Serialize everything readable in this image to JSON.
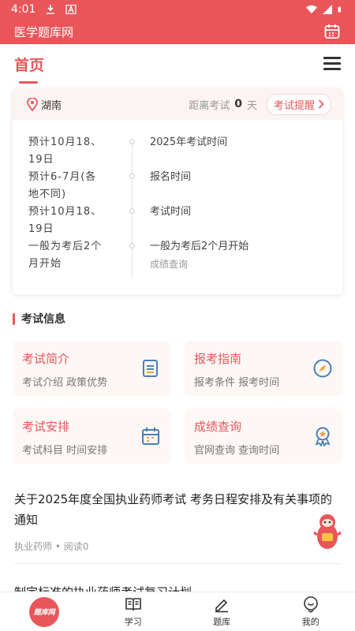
{
  "status_bar": {
    "time": "4:01"
  },
  "app_bar": {
    "title": "医学题库网"
  },
  "nav": {
    "home_label": "首页"
  },
  "exam_card": {
    "location": "湖南",
    "countdown_label": "距离考试",
    "countdown_days": "0",
    "countdown_unit": "天",
    "remind_label": "考试提醒",
    "schedule": [
      {
        "date": "预计10月18、19日",
        "event": "2025年考试时间",
        "sub": ""
      },
      {
        "date": "预计6-7月(各地不同)",
        "event": "报名时间",
        "sub": ""
      },
      {
        "date": "预计10月18、19日",
        "event": "考试时间",
        "sub": ""
      },
      {
        "date": "一般为考后2个月开始",
        "event": "一般为考后2个月开始",
        "sub": "成绩查询"
      }
    ]
  },
  "exam_info": {
    "section_title": "考试信息",
    "tiles": [
      {
        "title": "考试简介",
        "subtitle": "考试介绍 政策优势",
        "icon": "document-icon"
      },
      {
        "title": "报考指南",
        "subtitle": "报考条件 报考时间",
        "icon": "compass-icon"
      },
      {
        "title": "考试安排",
        "subtitle": "考试科目 时间安排",
        "icon": "calendar-icon"
      },
      {
        "title": "成绩查询",
        "subtitle": "官网查询 查询时间",
        "icon": "award-icon"
      }
    ]
  },
  "articles": [
    {
      "title": "关于2025年度全国执业药师考试 考务日程安排及有关事项的通知",
      "category": "执业药师",
      "reads": "阅读0"
    },
    {
      "title": "制定标准的执业药师考试复习计划"
    }
  ],
  "bottom_nav": {
    "logo_text": "题库网",
    "items": [
      {
        "label": "学习",
        "icon": "book-icon"
      },
      {
        "label": "题库",
        "icon": "pencil-icon"
      },
      {
        "label": "我的",
        "icon": "profile-icon"
      }
    ]
  },
  "colors": {
    "accent": "#e9565a",
    "tile_bg": "#fdf7f6",
    "icon_blue": "#4a7fb8",
    "icon_orange": "#f0a14a"
  }
}
